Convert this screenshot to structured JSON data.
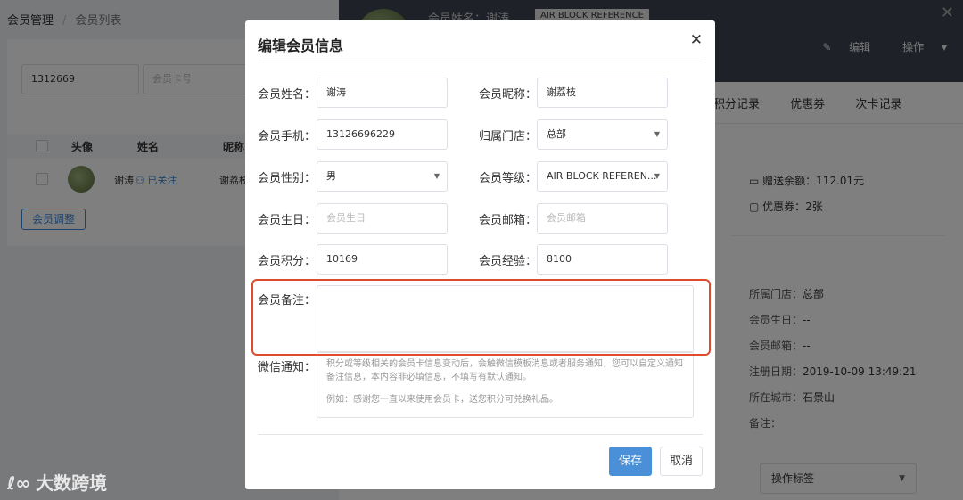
{
  "breadcrumb": {
    "parent": "会员管理",
    "current": "会员列表"
  },
  "filters": {
    "phone_value": "1312669",
    "card_placeholder": "会员卡号"
  },
  "table": {
    "headers": [
      "头像",
      "姓名",
      "昵称"
    ],
    "row": {
      "name": "谢涛",
      "follow_status": "已关注",
      "nickname": "谢荔枝"
    }
  },
  "list": {
    "adjust_button": "会员调整"
  },
  "drawer": {
    "name_label": "会员姓名：谢涛",
    "level_tag": "AIR BLOCK REFERENCE",
    "actions": {
      "edit": "编辑",
      "operate": "操作"
    },
    "tabs": [
      "积分记录",
      "优惠券",
      "次卡记录"
    ],
    "gift_balance": "赠送余额：112.01元",
    "coupons": "优惠券：2张",
    "info": [
      {
        "label": "所属门店：",
        "value": "总部"
      },
      {
        "label": "会员生日：",
        "value": "--"
      },
      {
        "label": "会员邮箱：",
        "value": "--"
      },
      {
        "label": "注册日期：",
        "value": "2019-10-09 13:49:21"
      },
      {
        "label": "所在城市：",
        "value": "石景山"
      },
      {
        "label": "备注：",
        "value": ""
      }
    ],
    "op_tag_select": "操作标签"
  },
  "modal": {
    "title": "编辑会员信息",
    "fields": {
      "name": {
        "label": "会员姓名：",
        "value": "谢涛"
      },
      "nickname": {
        "label": "会员昵称：",
        "value": "谢荔枝"
      },
      "phone": {
        "label": "会员手机：",
        "value": "13126696229"
      },
      "store": {
        "label": "归属门店：",
        "value": "总部"
      },
      "gender": {
        "label": "会员性别：",
        "value": "男"
      },
      "level": {
        "label": "会员等级：",
        "value": "AIR BLOCK REFEREN..."
      },
      "birthday": {
        "label": "会员生日：",
        "placeholder": "会员生日"
      },
      "email": {
        "label": "会员邮箱：",
        "placeholder": "会员邮箱"
      },
      "points": {
        "label": "会员积分：",
        "value": "10169"
      },
      "experience": {
        "label": "会员经验：",
        "value": "8100"
      },
      "remark": {
        "label": "会员备注："
      },
      "wechat": {
        "label": "微信通知：",
        "hint": "积分或等级相关的会员卡信息变动后，会触微信模板消息或者服务通知，您可以自定义通知备注信息，本内容非必填信息，不填写有默认通知。",
        "example": "例如：感谢您一直以来使用会员卡，送您积分可兑换礼品。"
      }
    },
    "save": "保存",
    "cancel": "取消"
  },
  "watermark": "大数跨境",
  "colors": {
    "primary": "#4a90d9",
    "highlight": "#e04a2f",
    "drawer_header": "#3d4451"
  }
}
